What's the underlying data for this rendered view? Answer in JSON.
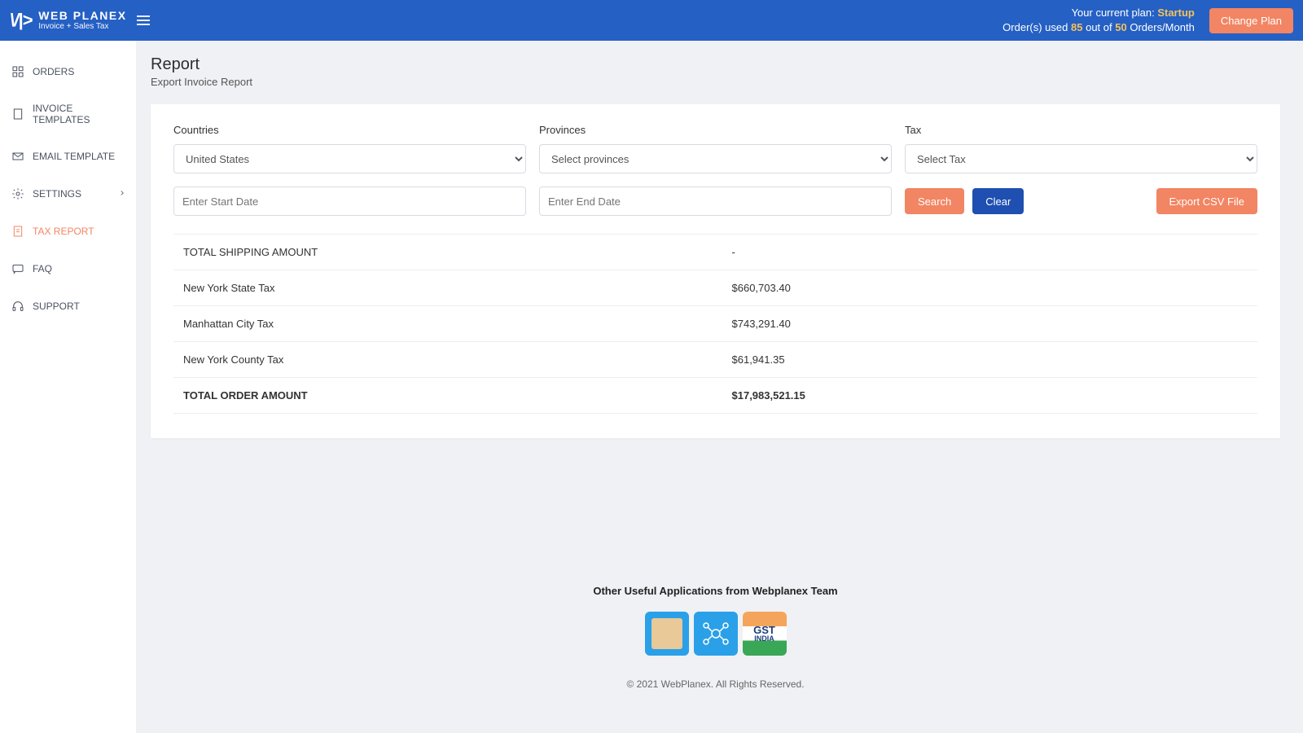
{
  "header": {
    "brand": "WEB PLANEX",
    "tagline": "Invoice + Sales Tax",
    "plan_label": "Your current plan:",
    "plan_name": "Startup",
    "orders_used_prefix": "Order(s) used",
    "orders_used": "85",
    "orders_out_of": "out of",
    "orders_limit": "50",
    "orders_suffix": "Orders/Month",
    "change_plan": "Change Plan"
  },
  "sidebar": {
    "items": [
      {
        "label": "ORDERS"
      },
      {
        "label": "INVOICE TEMPLATES"
      },
      {
        "label": "EMAIL TEMPLATE"
      },
      {
        "label": "SETTINGS"
      },
      {
        "label": "TAX REPORT"
      },
      {
        "label": "FAQ"
      },
      {
        "label": "SUPPORT"
      }
    ]
  },
  "page": {
    "title": "Report",
    "subtitle": "Export Invoice Report"
  },
  "filters": {
    "countries_label": "Countries",
    "countries_value": "United States",
    "provinces_label": "Provinces",
    "provinces_value": "Select provinces",
    "tax_label": "Tax",
    "tax_value": "Select Tax",
    "start_placeholder": "Enter Start Date",
    "end_placeholder": "Enter End Date",
    "search": "Search",
    "clear": "Clear",
    "export": "Export CSV File"
  },
  "report": {
    "rows": [
      {
        "label": "TOTAL SHIPPING AMOUNT",
        "value": "-",
        "bold": false
      },
      {
        "label": "New York State Tax",
        "value": "$660,703.40",
        "bold": false
      },
      {
        "label": "Manhattan City Tax",
        "value": "$743,291.40",
        "bold": false
      },
      {
        "label": "New York County Tax",
        "value": "$61,941.35",
        "bold": false
      },
      {
        "label": "TOTAL ORDER AMOUNT",
        "value": "$17,983,521.15",
        "bold": true
      }
    ]
  },
  "footer": {
    "title": "Other Useful Applications from Webplanex Team",
    "gst_top": "GST",
    "gst_bottom": "INDIA",
    "copyright": "© 2021 WebPlanex. All Rights Reserved."
  }
}
